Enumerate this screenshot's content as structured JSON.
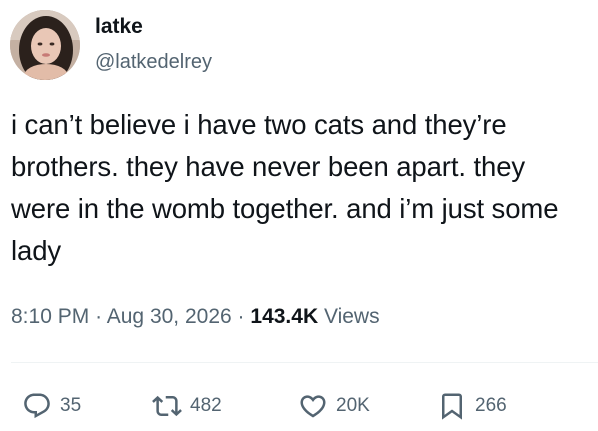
{
  "author": {
    "display_name": "latke",
    "handle": "@latkedelrey"
  },
  "tweet": {
    "text": "i can’t believe i have two cats and they’re brothers. they have never been apart. they were in the womb together. and i’m just some lady",
    "time": "8:10 PM",
    "date": "Aug 30, 2026",
    "views_count": "143.4K",
    "views_label": "Views",
    "separator": "·"
  },
  "actions": {
    "replies": "35",
    "retweets": "482",
    "likes": "20K",
    "bookmarks": "266"
  },
  "icons": {
    "reply": "reply-icon",
    "retweet": "retweet-icon",
    "like": "heart-icon",
    "bookmark": "bookmark-icon"
  },
  "colors": {
    "text_primary": "#0f1419",
    "text_secondary": "#536471",
    "divider": "#eff3f4"
  }
}
